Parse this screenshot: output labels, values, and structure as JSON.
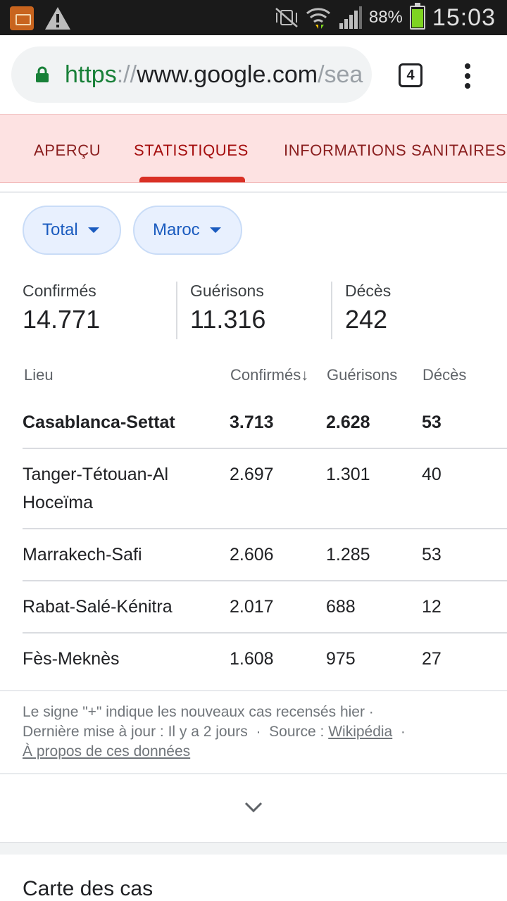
{
  "status_bar": {
    "battery_pct": "88%",
    "time": "15:03",
    "icons": [
      "video-app-icon",
      "warning-icon",
      "mute-vibrate-icon",
      "wifi-icon",
      "signal-icon",
      "battery-icon"
    ],
    "battery_color": "#7ed321"
  },
  "browser": {
    "url_scheme": "https",
    "url_sep": "://",
    "url_host": "www.google.com",
    "url_rest": "/sea",
    "tab_count": "4"
  },
  "tabs": [
    {
      "label": "APERÇU"
    },
    {
      "label": "STATISTIQUES",
      "active": true
    },
    {
      "label": "INFORMATIONS SANITAIRES"
    }
  ],
  "filters": {
    "scope": "Total",
    "region": "Maroc"
  },
  "summary": {
    "confirmed_label": "Confirmés",
    "confirmed_value": "14.771",
    "recovered_label": "Guérisons",
    "recovered_value": "11.316",
    "deaths_label": "Décès",
    "deaths_value": "242"
  },
  "table": {
    "headers": {
      "lieu": "Lieu",
      "confirmes": "Confirmés",
      "sort_arrow": "↓",
      "guerisons": "Guérisons",
      "deces": "Décès"
    },
    "rows": [
      {
        "lieu": "Casablanca-Settat",
        "confirmes": "3.713",
        "guerisons": "2.628",
        "deces": "53"
      },
      {
        "lieu": "Tanger-Tétouan-Al Hoceïma",
        "confirmes": "2.697",
        "guerisons": "1.301",
        "deces": "40"
      },
      {
        "lieu": "Marrakech-Safi",
        "confirmes": "2.606",
        "guerisons": "1.285",
        "deces": "53"
      },
      {
        "lieu": "Rabat-Salé-Kénitra",
        "confirmes": "2.017",
        "guerisons": "688",
        "deces": "12"
      },
      {
        "lieu": "Fès-Meknès",
        "confirmes": "1.608",
        "guerisons": "975",
        "deces": "27"
      }
    ]
  },
  "footer": {
    "note": "Le signe \"+\" indique les nouveaux cas recensés hier ·",
    "updated": "Dernière mise à jour : Il y a 2 jours",
    "dot": "·",
    "source_label": "Source :",
    "source_link": "Wikipédia",
    "about_link": "À propos de ces données"
  },
  "next_section": {
    "title": "Carte des cas"
  },
  "colors": {
    "accent_red": "#d93025",
    "tab_bg": "#fde2e2",
    "chip_blue": "#1a5bbf"
  }
}
